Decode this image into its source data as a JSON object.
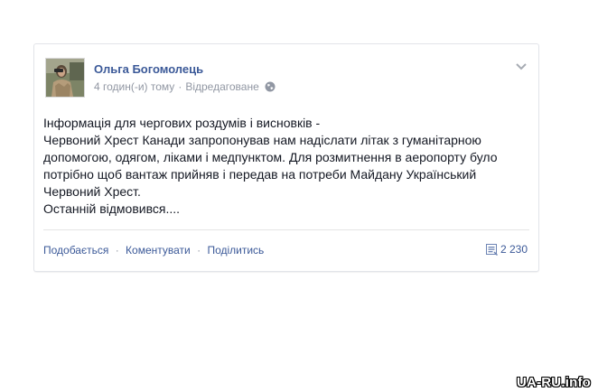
{
  "post": {
    "author": "Ольга Богомолець",
    "timestamp": "4 годин(-и) тому",
    "edited": "Відредаговане",
    "privacy_icon": "globe-icon",
    "options_icon": "chevron-down-icon",
    "text_lines": [
      "Інформація для чергових роздумів і висновків -",
      "Червоний Хрест Канади запропонував нам надіслати літак з гуманітарною",
      "допомогою, одягом, ліками і медпунктом. Для розмитнення в аеропорту було",
      "потрібно щоб вантаж прийняв і передав на потреби Майдану Український",
      "Червоний Хрест.",
      "Останній відмовився...."
    ],
    "actions": {
      "like": "Подобається",
      "comment": "Коментувати",
      "share": "Поділитись",
      "separator": "·"
    },
    "shares_count": "2 230",
    "shares_icon": "share-icon"
  },
  "watermark": "UA-RU.info",
  "colors": {
    "link": "#3b5998",
    "meta": "#9197a3",
    "text": "#141823"
  }
}
